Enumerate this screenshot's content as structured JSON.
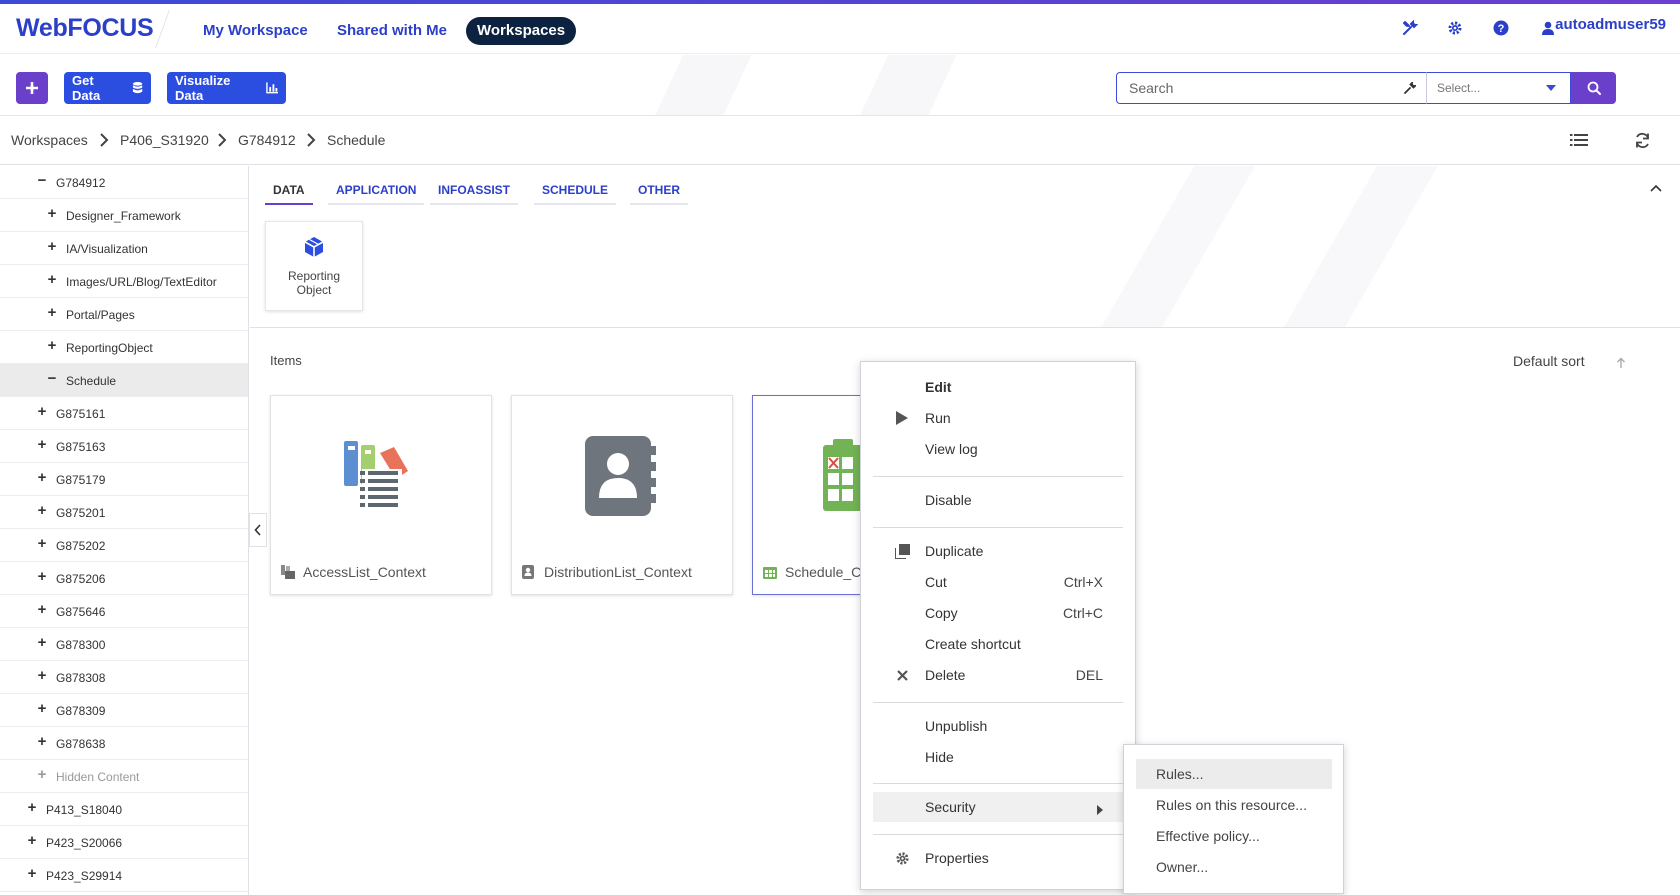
{
  "app": {
    "logo": "WebFOCUS",
    "user": "autoadmuser59"
  },
  "nav": {
    "my_workspace": "My Workspace",
    "shared": "Shared with Me",
    "workspaces": "Workspaces"
  },
  "toolbar": {
    "get_data": "Get Data",
    "visualize": "Visualize Data",
    "search_placeholder": "Search",
    "select_value": "Select..."
  },
  "breadcrumb": [
    "Workspaces",
    "P406_S31920",
    "G784912",
    "Schedule"
  ],
  "tree": [
    {
      "sign": "−",
      "label": "G784912"
    },
    {
      "sign": "+",
      "label": "Designer_Framework"
    },
    {
      "sign": "+",
      "label": "IA/Visualization"
    },
    {
      "sign": "+",
      "label": "Images/URL/Blog/TextEditor"
    },
    {
      "sign": "+",
      "label": "Portal/Pages"
    },
    {
      "sign": "+",
      "label": "ReportingObject"
    },
    {
      "sign": "−",
      "label": "Schedule"
    },
    {
      "sign": "+",
      "label": "G875161"
    },
    {
      "sign": "+",
      "label": "G875163"
    },
    {
      "sign": "+",
      "label": "G875179"
    },
    {
      "sign": "+",
      "label": "G875201"
    },
    {
      "sign": "+",
      "label": "G875202"
    },
    {
      "sign": "+",
      "label": "G875206"
    },
    {
      "sign": "+",
      "label": "G875646"
    },
    {
      "sign": "+",
      "label": "G878300"
    },
    {
      "sign": "+",
      "label": "G878308"
    },
    {
      "sign": "+",
      "label": "G878309"
    },
    {
      "sign": "+",
      "label": "G878638"
    },
    {
      "sign": "+",
      "label": "Hidden Content"
    },
    {
      "sign": "+",
      "label": "P413_S18040"
    },
    {
      "sign": "+",
      "label": "P423_S20066"
    },
    {
      "sign": "+",
      "label": "P423_S29914"
    }
  ],
  "tabs": [
    "DATA",
    "APPLICATION",
    "INFOASSIST",
    "SCHEDULE",
    "OTHER"
  ],
  "tile": {
    "label": "Reporting Object"
  },
  "items": {
    "label": "Items",
    "sort": "Default sort",
    "cards": [
      "AccessList_Context",
      "DistributionList_Context",
      "Schedule_Co"
    ]
  },
  "context_menu": {
    "edit": "Edit",
    "run": "Run",
    "view_log": "View log",
    "disable": "Disable",
    "duplicate": "Duplicate",
    "cut": "Cut",
    "cut_sc": "Ctrl+X",
    "copy": "Copy",
    "copy_sc": "Ctrl+C",
    "shortcut": "Create shortcut",
    "delete": "Delete",
    "delete_sc": "DEL",
    "unpublish": "Unpublish",
    "hide": "Hide",
    "security": "Security",
    "properties": "Properties"
  },
  "security_menu": [
    "Rules...",
    "Rules on this resource...",
    "Effective policy...",
    "Owner..."
  ]
}
